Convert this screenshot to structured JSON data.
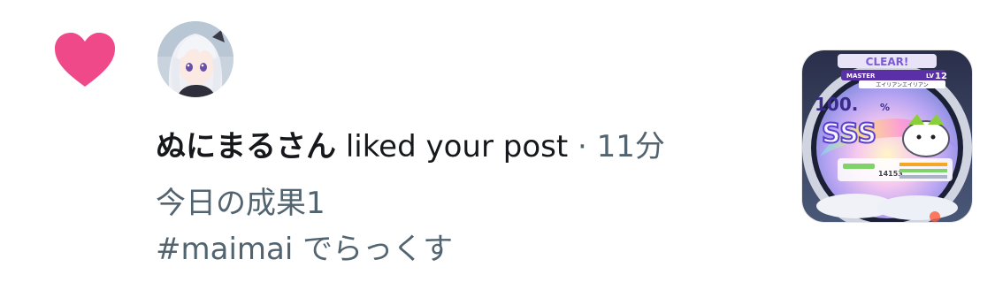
{
  "notification": {
    "icon": "heart-icon",
    "heart_color": "#f0498a",
    "username": "ぬにまるさん",
    "action_text": "liked your post",
    "separator": "·",
    "time": "11分",
    "post_text_line1": "今日の成果1",
    "post_text_line2": "#maimai でらっくす"
  },
  "thumbnail": {
    "clear_text": "CLEAR!",
    "difficulty": "MASTER",
    "level": "12",
    "song_title": "エイリアンエイリアン",
    "rank": "SSS",
    "score": "100.",
    "score_suffix": "%",
    "small_value": "14153"
  }
}
